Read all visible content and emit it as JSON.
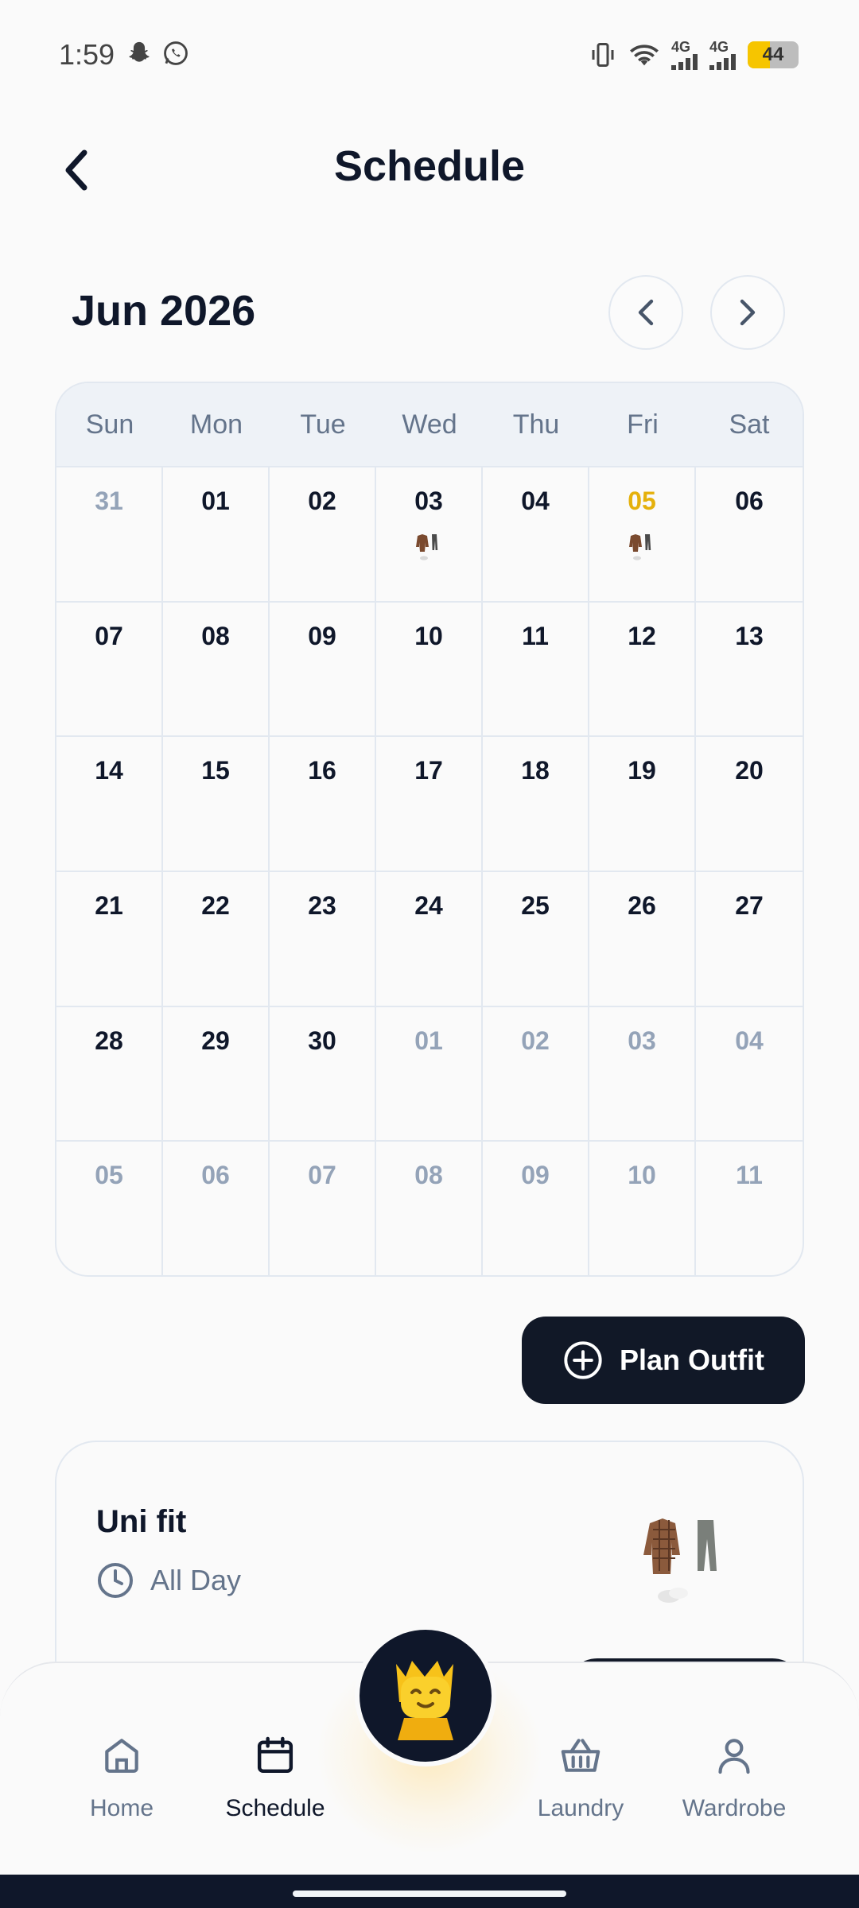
{
  "status_bar": {
    "time": "1:59",
    "battery": "44",
    "network_1": "4G",
    "network_2": "4G"
  },
  "header": {
    "title": "Schedule"
  },
  "calendar": {
    "month_label": "Jun 2026",
    "weekdays": [
      "Sun",
      "Mon",
      "Tue",
      "Wed",
      "Thu",
      "Fri",
      "Sat"
    ],
    "days": [
      {
        "d": "31",
        "out": true
      },
      {
        "d": "01"
      },
      {
        "d": "02"
      },
      {
        "d": "03",
        "outfit": true
      },
      {
        "d": "04"
      },
      {
        "d": "05",
        "today": true,
        "outfit": true
      },
      {
        "d": "06"
      },
      {
        "d": "07"
      },
      {
        "d": "08"
      },
      {
        "d": "09"
      },
      {
        "d": "10"
      },
      {
        "d": "11"
      },
      {
        "d": "12"
      },
      {
        "d": "13"
      },
      {
        "d": "14"
      },
      {
        "d": "15"
      },
      {
        "d": "16"
      },
      {
        "d": "17"
      },
      {
        "d": "18"
      },
      {
        "d": "19"
      },
      {
        "d": "20"
      },
      {
        "d": "21"
      },
      {
        "d": "22"
      },
      {
        "d": "23"
      },
      {
        "d": "24"
      },
      {
        "d": "25"
      },
      {
        "d": "26"
      },
      {
        "d": "27"
      },
      {
        "d": "28"
      },
      {
        "d": "29"
      },
      {
        "d": "30"
      },
      {
        "d": "01",
        "out": true
      },
      {
        "d": "02",
        "out": true
      },
      {
        "d": "03",
        "out": true
      },
      {
        "d": "04",
        "out": true
      },
      {
        "d": "05",
        "out": true
      },
      {
        "d": "06",
        "out": true
      },
      {
        "d": "07",
        "out": true
      },
      {
        "d": "08",
        "out": true
      },
      {
        "d": "09",
        "out": true
      },
      {
        "d": "10",
        "out": true
      },
      {
        "d": "11",
        "out": true
      }
    ]
  },
  "actions": {
    "plan_outfit_label": "Plan Outfit"
  },
  "event": {
    "title": "Uni fit",
    "time": "All Day"
  },
  "bottom_nav": {
    "home": "Home",
    "schedule": "Schedule",
    "laundry": "Laundry",
    "wardrobe": "Wardrobe"
  },
  "colors": {
    "accent": "#e5b10c",
    "primary_dark": "#111827",
    "muted": "#64748b"
  }
}
